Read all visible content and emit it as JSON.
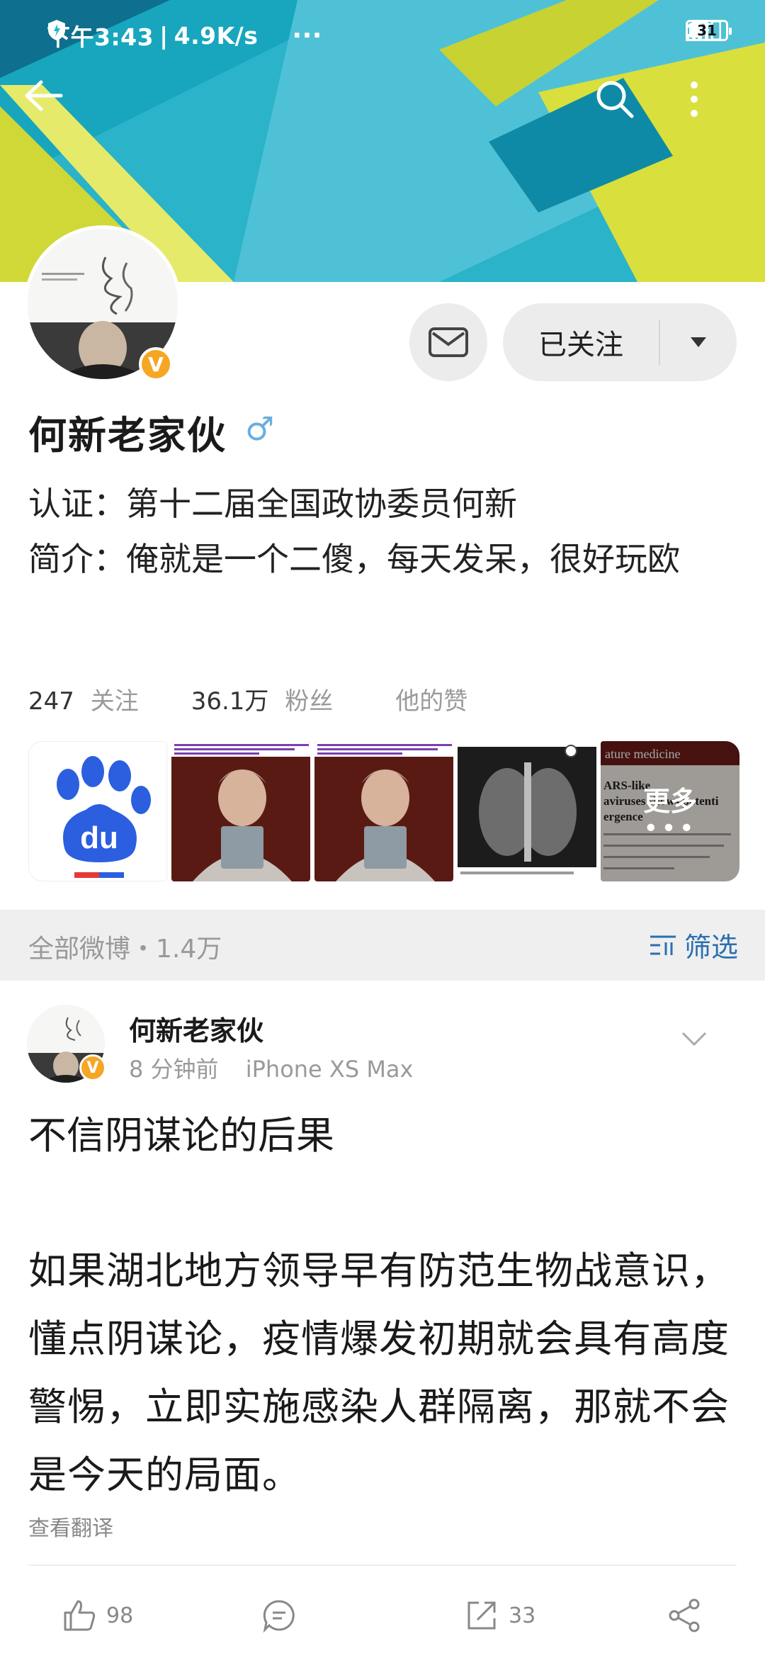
{
  "status_bar": {
    "time": "下午3:43",
    "network_speed": "4.9K/s",
    "battery": "31",
    "icons": [
      "shield-icon",
      "more-dots-icon",
      "signal-icon",
      "wifi-icon",
      "battery-icon"
    ]
  },
  "nav": {
    "icons": [
      "back-arrow-icon",
      "search-icon",
      "more-vertical-icon"
    ]
  },
  "profile": {
    "name": "何新老家伙",
    "gender_symbol": "♂",
    "verified_badge": "V",
    "certification": "认证：第十二届全国政协委员何新",
    "intro": "简介：俺就是一个二傻，每天发呆，很好玩欧",
    "follow_button": "已关注",
    "stats": {
      "following_count": "247",
      "following_label": "关注",
      "followers_count": "36.1万",
      "followers_label": "粉丝",
      "likes_label": "他的赞"
    }
  },
  "photos": {
    "more_label": "更多",
    "more_dots": "•••",
    "baidu_logo_text": "du",
    "journal_header": "ature medicine",
    "journal_excerpt": [
      "ARS-like",
      "aviruses shows potenti",
      "ergence"
    ]
  },
  "filter": {
    "all_posts": "全部微博・1.4万",
    "filter_label": "筛选"
  },
  "post": {
    "author": "何新老家伙",
    "time": "8 分钟前",
    "device": "iPhone XS Max",
    "title": "不信阴谋论的后果",
    "body": "如果湖北地方领导早有防范生物战意识，懂点阴谋论，疫情爆发初期就会具有高度警惕，立即实施感染人群隔离，那就不会是今天的局面。",
    "translate": "查看翻译",
    "likes": "98",
    "reposts": "33"
  },
  "colors": {
    "banner_teal": "#1ab7c9",
    "banner_yellow": "#d4dc3a",
    "accent_blue": "#2a6fb0",
    "badge_orange": "#f5a623"
  }
}
